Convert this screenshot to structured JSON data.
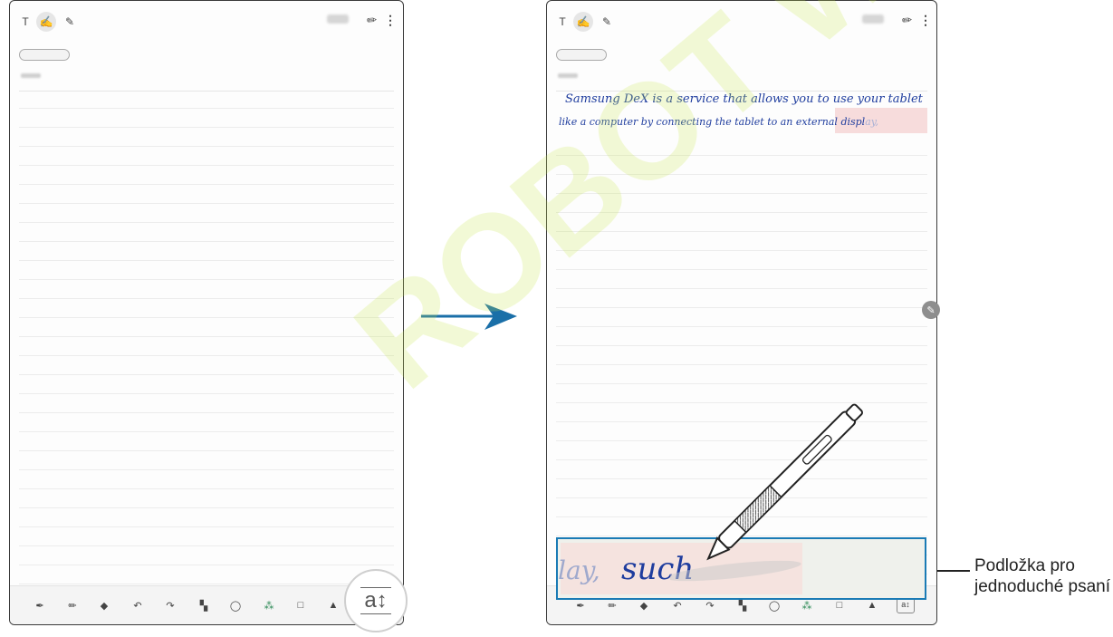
{
  "handwriting": {
    "line1": "Samsung DeX is a  service that allows you to use your tablet",
    "line2": "like a computer by  connecting the tablet  to an external displ",
    "line2_tail": "ay,"
  },
  "writing_pad": {
    "prev_text": "lay,",
    "current_text": "such"
  },
  "zoom": {
    "glyph": "a↕"
  },
  "caption": {
    "label": "Podložka pro jednoduché psaní"
  },
  "watermark": {
    "text": "ROBOT WORLD"
  },
  "colors": {
    "accent": "#1a7bb5",
    "ink": "#1f3d9e",
    "highlight": "#f7dcdc",
    "watermark_green": "#c8e84a",
    "watermark_orange": "#f5c79a"
  },
  "icons": {
    "top": [
      "text-mode-icon",
      "pen-mode-icon",
      "brush-mode-icon",
      "attach-icon",
      "more-options-icon"
    ],
    "bottom": [
      "pen-tool-icon",
      "highlighter-icon",
      "eraser-icon",
      "undo-icon",
      "redo-icon",
      "text-insert-icon",
      "lasso-icon",
      "color-icon",
      "shape-icon",
      "style-icon",
      "writing-pad-icon"
    ]
  }
}
